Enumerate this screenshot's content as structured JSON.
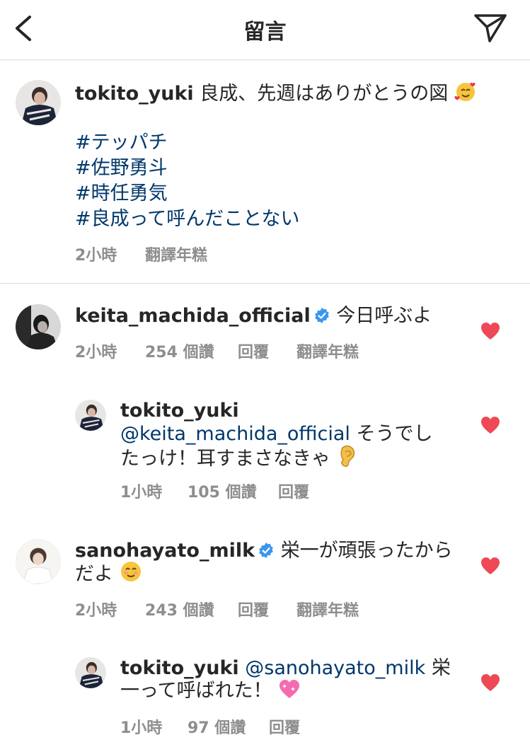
{
  "header": {
    "title": "留言"
  },
  "caption": {
    "username": "tokito_yuki",
    "text": " 良成、先週はありがとうの図",
    "hashtags": [
      "#テッパチ",
      "#佐野勇斗",
      "#時任勇気",
      "#良成って呼んだことない"
    ],
    "time": "2小時",
    "translate": "翻譯年糕"
  },
  "comments": [
    {
      "username": "keita_machida_official",
      "verified": true,
      "text": " 今日呼ぶよ",
      "time": "2小時",
      "likes": "254 個讚",
      "reply": "回覆",
      "translate": "翻譯年糕",
      "replies": [
        {
          "username": "tokito_yuki",
          "mention": "@keita_machida_official",
          "text_line1": " そうでし",
          "text_line2": "たっけ！耳すまさなきゃ",
          "time": "1小時",
          "likes": "105 個讚",
          "reply": "回覆"
        }
      ]
    },
    {
      "username": "sanohayato_milk",
      "verified": true,
      "text_line1": " 栄一が頑張ったから",
      "text_line2": "だよ",
      "time": "2小時",
      "likes": "243 個讚",
      "reply": "回覆",
      "translate": "翻譯年糕",
      "replies": [
        {
          "username": "tokito_yuki",
          "mention": "@sanohayato_milk",
          "text_line1": " 栄",
          "text_line2": "一って呼ばれた！",
          "time": "1小時",
          "likes": "97 個讚",
          "reply": "回覆"
        }
      ]
    }
  ],
  "icons": {
    "back": "chevron-left-icon",
    "send": "paper-plane-icon",
    "heart": "heart-icon",
    "verified": "verified-badge-icon"
  },
  "colors": {
    "heart": "#ed4956",
    "verified": "#3897f0",
    "link": "#00376b",
    "meta": "#8e8e8e"
  }
}
